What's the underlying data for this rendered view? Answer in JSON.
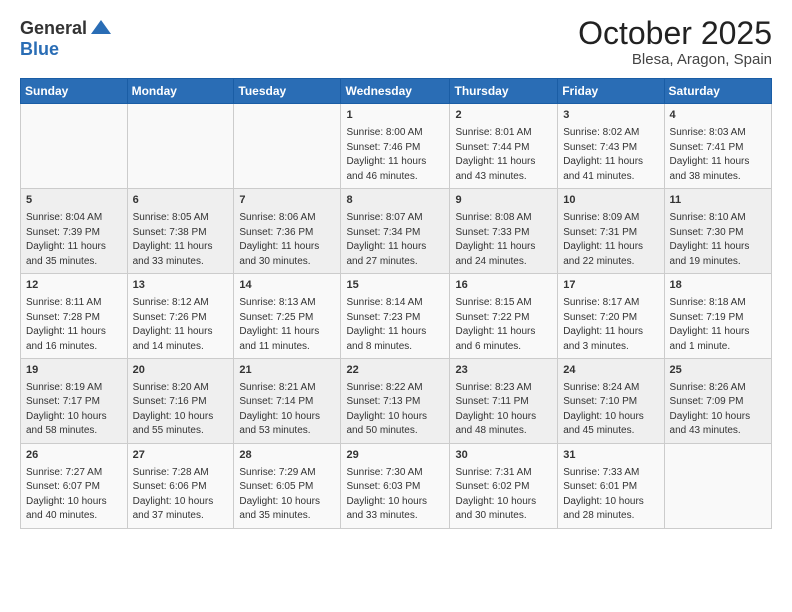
{
  "header": {
    "logo_general": "General",
    "logo_blue": "Blue",
    "title": "October 2025",
    "subtitle": "Blesa, Aragon, Spain"
  },
  "calendar": {
    "weekdays": [
      "Sunday",
      "Monday",
      "Tuesday",
      "Wednesday",
      "Thursday",
      "Friday",
      "Saturday"
    ],
    "weeks": [
      [
        {
          "day": "",
          "info": ""
        },
        {
          "day": "",
          "info": ""
        },
        {
          "day": "",
          "info": ""
        },
        {
          "day": "1",
          "info": "Sunrise: 8:00 AM\nSunset: 7:46 PM\nDaylight: 11 hours and 46 minutes."
        },
        {
          "day": "2",
          "info": "Sunrise: 8:01 AM\nSunset: 7:44 PM\nDaylight: 11 hours and 43 minutes."
        },
        {
          "day": "3",
          "info": "Sunrise: 8:02 AM\nSunset: 7:43 PM\nDaylight: 11 hours and 41 minutes."
        },
        {
          "day": "4",
          "info": "Sunrise: 8:03 AM\nSunset: 7:41 PM\nDaylight: 11 hours and 38 minutes."
        }
      ],
      [
        {
          "day": "5",
          "info": "Sunrise: 8:04 AM\nSunset: 7:39 PM\nDaylight: 11 hours and 35 minutes."
        },
        {
          "day": "6",
          "info": "Sunrise: 8:05 AM\nSunset: 7:38 PM\nDaylight: 11 hours and 33 minutes."
        },
        {
          "day": "7",
          "info": "Sunrise: 8:06 AM\nSunset: 7:36 PM\nDaylight: 11 hours and 30 minutes."
        },
        {
          "day": "8",
          "info": "Sunrise: 8:07 AM\nSunset: 7:34 PM\nDaylight: 11 hours and 27 minutes."
        },
        {
          "day": "9",
          "info": "Sunrise: 8:08 AM\nSunset: 7:33 PM\nDaylight: 11 hours and 24 minutes."
        },
        {
          "day": "10",
          "info": "Sunrise: 8:09 AM\nSunset: 7:31 PM\nDaylight: 11 hours and 22 minutes."
        },
        {
          "day": "11",
          "info": "Sunrise: 8:10 AM\nSunset: 7:30 PM\nDaylight: 11 hours and 19 minutes."
        }
      ],
      [
        {
          "day": "12",
          "info": "Sunrise: 8:11 AM\nSunset: 7:28 PM\nDaylight: 11 hours and 16 minutes."
        },
        {
          "day": "13",
          "info": "Sunrise: 8:12 AM\nSunset: 7:26 PM\nDaylight: 11 hours and 14 minutes."
        },
        {
          "day": "14",
          "info": "Sunrise: 8:13 AM\nSunset: 7:25 PM\nDaylight: 11 hours and 11 minutes."
        },
        {
          "day": "15",
          "info": "Sunrise: 8:14 AM\nSunset: 7:23 PM\nDaylight: 11 hours and 8 minutes."
        },
        {
          "day": "16",
          "info": "Sunrise: 8:15 AM\nSunset: 7:22 PM\nDaylight: 11 hours and 6 minutes."
        },
        {
          "day": "17",
          "info": "Sunrise: 8:17 AM\nSunset: 7:20 PM\nDaylight: 11 hours and 3 minutes."
        },
        {
          "day": "18",
          "info": "Sunrise: 8:18 AM\nSunset: 7:19 PM\nDaylight: 11 hours and 1 minute."
        }
      ],
      [
        {
          "day": "19",
          "info": "Sunrise: 8:19 AM\nSunset: 7:17 PM\nDaylight: 10 hours and 58 minutes."
        },
        {
          "day": "20",
          "info": "Sunrise: 8:20 AM\nSunset: 7:16 PM\nDaylight: 10 hours and 55 minutes."
        },
        {
          "day": "21",
          "info": "Sunrise: 8:21 AM\nSunset: 7:14 PM\nDaylight: 10 hours and 53 minutes."
        },
        {
          "day": "22",
          "info": "Sunrise: 8:22 AM\nSunset: 7:13 PM\nDaylight: 10 hours and 50 minutes."
        },
        {
          "day": "23",
          "info": "Sunrise: 8:23 AM\nSunset: 7:11 PM\nDaylight: 10 hours and 48 minutes."
        },
        {
          "day": "24",
          "info": "Sunrise: 8:24 AM\nSunset: 7:10 PM\nDaylight: 10 hours and 45 minutes."
        },
        {
          "day": "25",
          "info": "Sunrise: 8:26 AM\nSunset: 7:09 PM\nDaylight: 10 hours and 43 minutes."
        }
      ],
      [
        {
          "day": "26",
          "info": "Sunrise: 7:27 AM\nSunset: 6:07 PM\nDaylight: 10 hours and 40 minutes."
        },
        {
          "day": "27",
          "info": "Sunrise: 7:28 AM\nSunset: 6:06 PM\nDaylight: 10 hours and 37 minutes."
        },
        {
          "day": "28",
          "info": "Sunrise: 7:29 AM\nSunset: 6:05 PM\nDaylight: 10 hours and 35 minutes."
        },
        {
          "day": "29",
          "info": "Sunrise: 7:30 AM\nSunset: 6:03 PM\nDaylight: 10 hours and 33 minutes."
        },
        {
          "day": "30",
          "info": "Sunrise: 7:31 AM\nSunset: 6:02 PM\nDaylight: 10 hours and 30 minutes."
        },
        {
          "day": "31",
          "info": "Sunrise: 7:33 AM\nSunset: 6:01 PM\nDaylight: 10 hours and 28 minutes."
        },
        {
          "day": "",
          "info": ""
        }
      ]
    ]
  }
}
